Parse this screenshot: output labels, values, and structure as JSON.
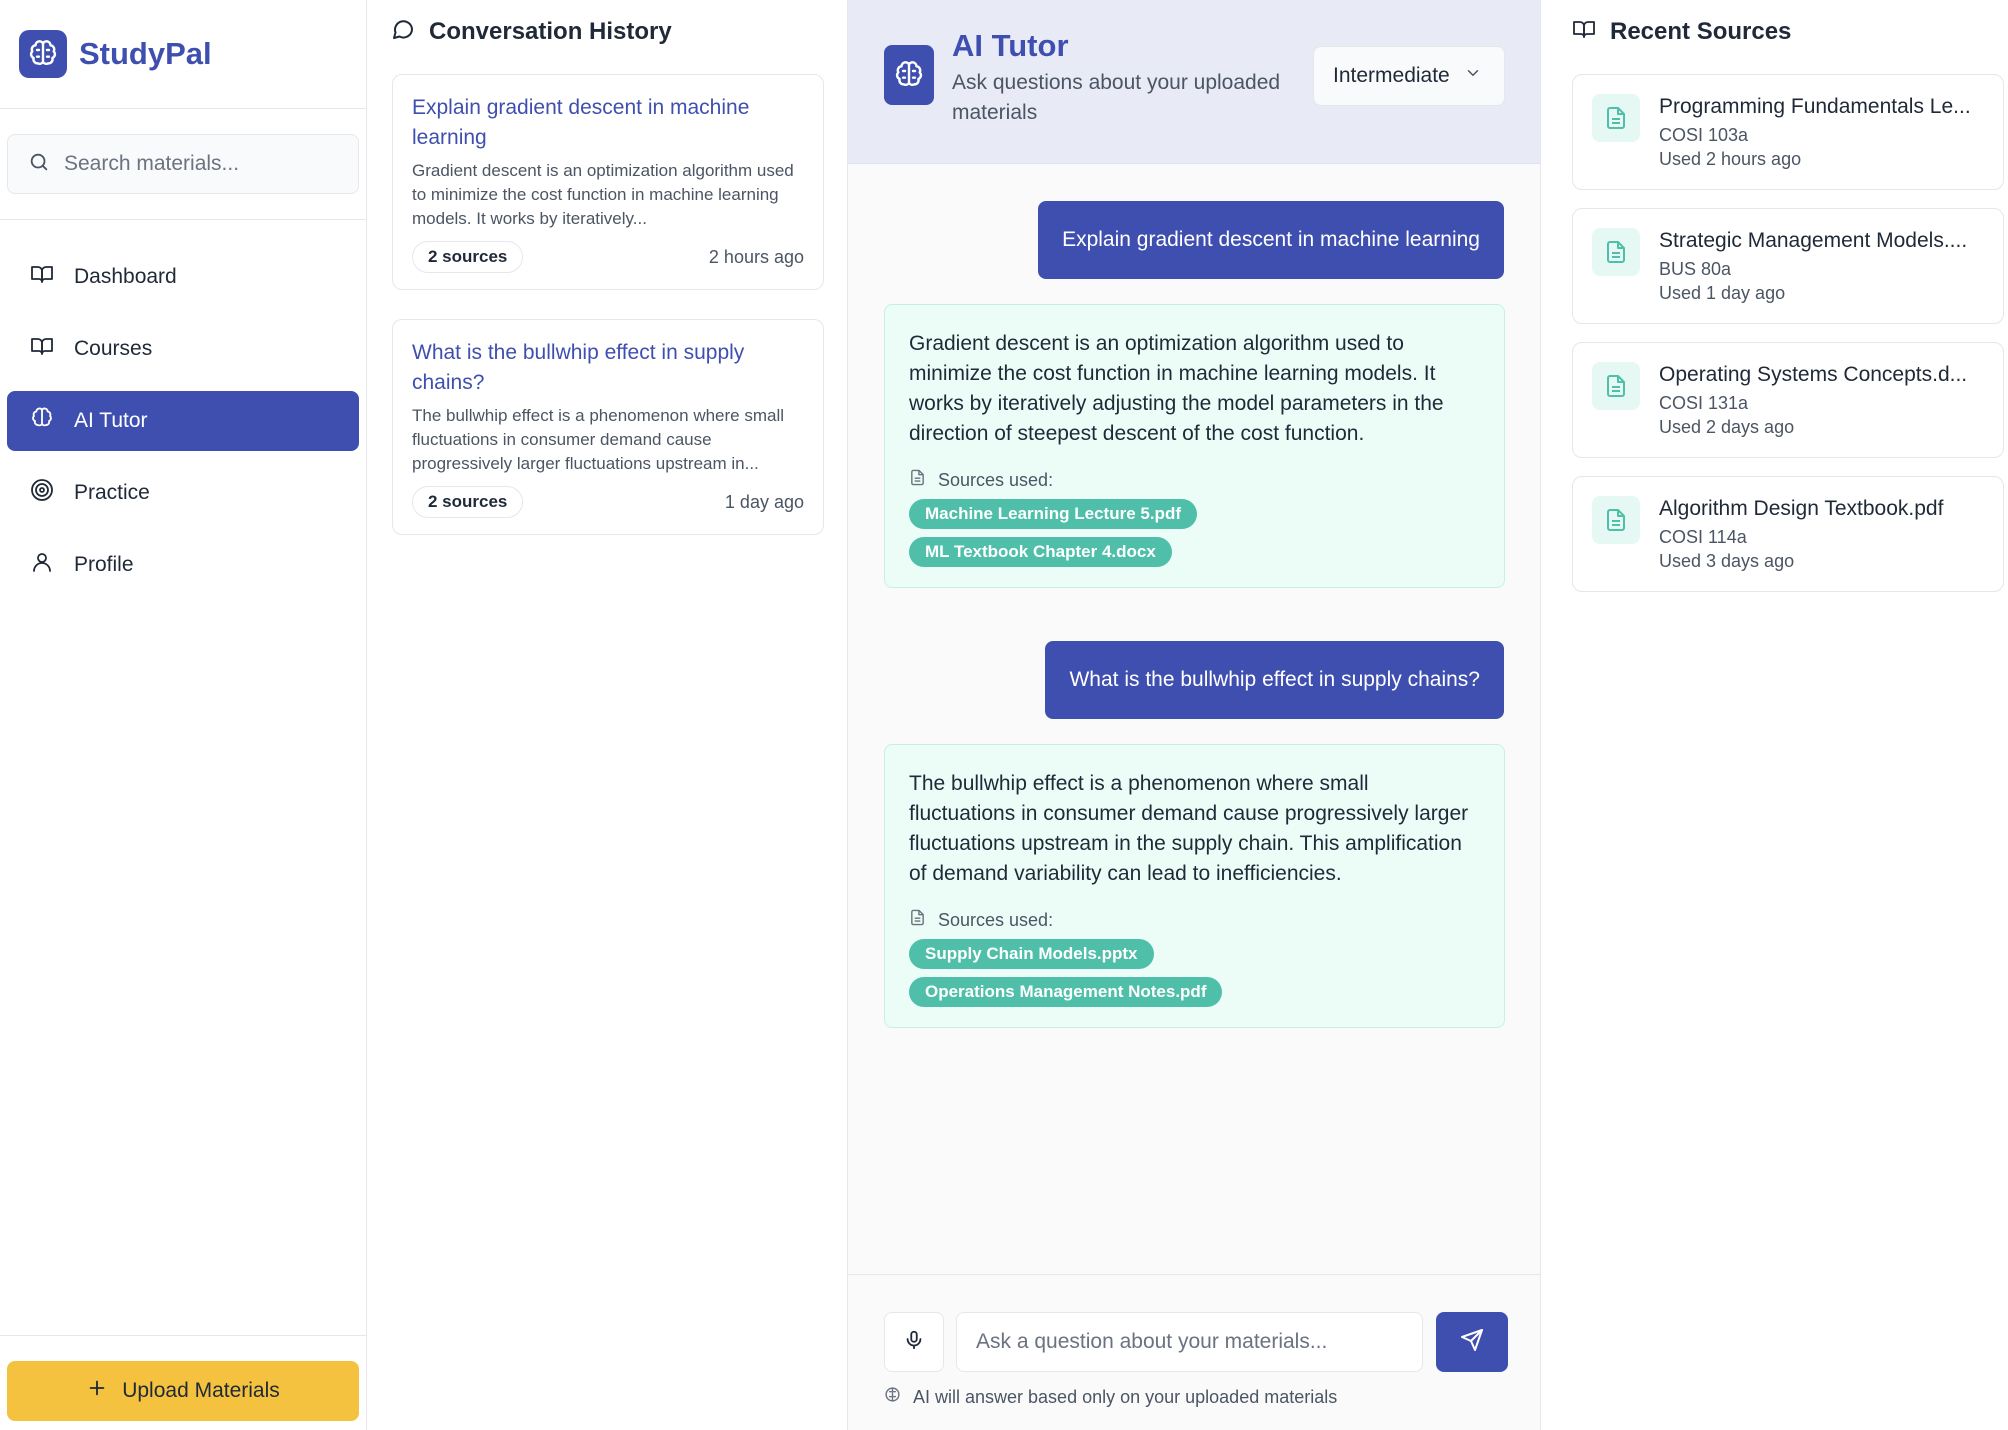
{
  "brand": {
    "name": "StudyPal",
    "accent": "#3f4fb0"
  },
  "search": {
    "placeholder": "Search materials..."
  },
  "nav": [
    {
      "label": "Dashboard",
      "icon": "book-open-icon"
    },
    {
      "label": "Courses",
      "icon": "book-open-icon"
    },
    {
      "label": "AI Tutor",
      "icon": "brain-icon",
      "active": true
    },
    {
      "label": "Practice",
      "icon": "target-icon"
    },
    {
      "label": "Profile",
      "icon": "user-icon"
    }
  ],
  "upload": {
    "label": "Upload Materials",
    "color": "#f4c23e"
  },
  "history": {
    "title": "Conversation History",
    "items": [
      {
        "title": "Explain gradient descent in machine learning",
        "snippet": "Gradient descent is an optimization algorithm used to minimize the cost function in machine learning models. It works by iteratively...",
        "sources": "2 sources",
        "ago": "2 hours ago"
      },
      {
        "title": "What is the bullwhip effect in supply chains?",
        "snippet": "The bullwhip effect is a phenomenon where small fluctuations in consumer demand cause progressively larger fluctuations upstream in...",
        "sources": "2 sources",
        "ago": "1 day ago"
      }
    ]
  },
  "chat": {
    "title": "AI Tutor",
    "subtitle": "Ask questions about your uploaded materials",
    "level": "Intermediate",
    "sources_label": "Sources used:",
    "messages": [
      {
        "role": "user",
        "text": "Explain gradient descent in machine learning"
      },
      {
        "role": "ai",
        "text": "Gradient descent is an optimization algorithm used to minimize the cost function in machine learning models. It works by iteratively adjusting the model parameters in the direction of steepest descent of the cost function.",
        "sources": [
          "Machine Learning Lecture 5.pdf",
          "ML Textbook Chapter 4.docx"
        ]
      },
      {
        "role": "user",
        "text": "What is the bullwhip effect in supply chains?"
      },
      {
        "role": "ai",
        "text": "The bullwhip effect is a phenomenon where small fluctuations in consumer demand cause progressively larger fluctuations upstream in the supply chain. This amplification of demand variability can lead to inefficiencies.",
        "sources": [
          "Supply Chain Models.pptx",
          "Operations Management Notes.pdf"
        ]
      }
    ],
    "input_placeholder": "Ask a question about your materials...",
    "hint": "AI will answer based only on your uploaded materials"
  },
  "recent": {
    "title": "Recent Sources",
    "items": [
      {
        "name": "Programming Fundamentals Le...",
        "course": "COSI 103a",
        "used": "Used 2 hours ago"
      },
      {
        "name": "Strategic Management Models....",
        "course": "BUS 80a",
        "used": "Used 1 day ago"
      },
      {
        "name": "Operating Systems Concepts.d...",
        "course": "COSI 131a",
        "used": "Used 2 days ago"
      },
      {
        "name": "Algorithm Design Textbook.pdf",
        "course": "COSI 114a",
        "used": "Used 3 days ago"
      }
    ]
  },
  "colors": {
    "accent": "#3f4fb0",
    "ai_bubble": "#ecfdf8",
    "source_chip": "#4fbfaa",
    "upload": "#f4c23e",
    "header_bg": "#e8eaf6"
  }
}
